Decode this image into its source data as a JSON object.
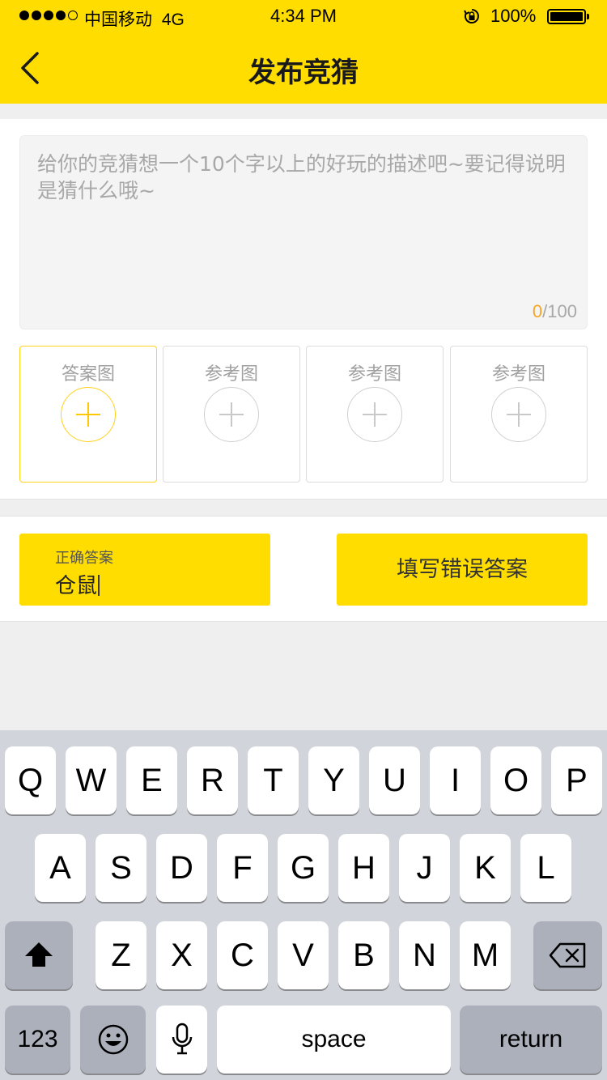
{
  "status_bar": {
    "carrier": "中国移动",
    "network": "4G",
    "time": "4:34 PM",
    "battery": "100%"
  },
  "nav": {
    "title": "发布竞猜"
  },
  "description": {
    "placeholder": "给你的竞猜想一个10个字以上的好玩的描述吧~要记得说明是猜什么哦~",
    "count": "0",
    "max": "/100"
  },
  "image_tiles": [
    {
      "label": "答案图",
      "active": true
    },
    {
      "label": "参考图",
      "active": false
    },
    {
      "label": "参考图",
      "active": false
    },
    {
      "label": "参考图",
      "active": false
    }
  ],
  "answers": {
    "correct_label": "正确答案",
    "correct_value": "仓鼠",
    "wrong_button": "填写错误答案"
  },
  "keyboard": {
    "row1": [
      "Q",
      "W",
      "E",
      "R",
      "T",
      "Y",
      "U",
      "I",
      "O",
      "P"
    ],
    "row2": [
      "A",
      "S",
      "D",
      "F",
      "G",
      "H",
      "J",
      "K",
      "L"
    ],
    "row3": [
      "Z",
      "X",
      "C",
      "V",
      "B",
      "N",
      "M"
    ],
    "numbers_key": "123",
    "space_key": "space",
    "return_key": "return"
  },
  "colors": {
    "brand_yellow": "#ffdd00",
    "counter_orange": "#f5a623"
  }
}
